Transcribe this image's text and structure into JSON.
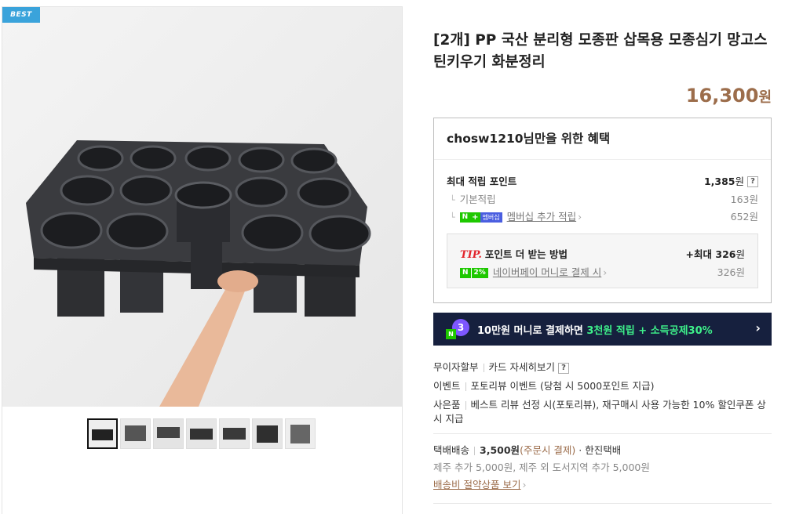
{
  "gallery": {
    "badge": "BEST",
    "thumbnail_count": 7
  },
  "product": {
    "title": "[2개] PP 국산 분리형 모종판 삽목용 모종심기 망고스틴키우기 화분정리",
    "price": "16,300",
    "currency": "원"
  },
  "benefit": {
    "heading": "chosw1210님만을 위한 혜택",
    "max_points_label": "최대 적립 포인트",
    "max_points_value": "1,385",
    "won": "원",
    "help": "?",
    "basic_label": "기본적립",
    "basic_value": "163원",
    "n_mark": "N",
    "plus_mark": "+",
    "membership_chip": "멤버십",
    "membership_label": "멤버십 추가 적립",
    "membership_value": "652원",
    "chevron": "›",
    "tip": {
      "label": "TIP.",
      "text": "포인트 더 받는 방법",
      "max_prefix": "+최대",
      "max_value": "326",
      "pct_chip": "2%",
      "npay_label": "네이버페이 머니로 결제 시",
      "npay_value": "326원"
    }
  },
  "banner": {
    "icon_number": "3",
    "text_prefix": "10만원 머니로 결제하면 ",
    "text_highlight": "3천원 적립 + 소득공제30%",
    "arrow": "›"
  },
  "info": {
    "installment": "무이자할부",
    "card_detail": "카드 자세히보기",
    "event_label": "이벤트",
    "event_text": "포토리뷰 이벤트 (당첨 시 5000포인트 지급)",
    "gift_label": "사은품",
    "gift_text": "베스트 리뷰 선정 시(포토리뷰), 재구매시 사용 가능한 10% 할인쿠폰 상시 지급"
  },
  "shipping": {
    "label": "택배배송",
    "fee": "3,500원",
    "fee_note": "(주문시 결제)",
    "carrier": "· 한진택배",
    "extra": "제주 추가 5,000원, 제주 외 도서지역 추가 5,000원",
    "saving_link": "배송비 절약상품 보기"
  },
  "colors": {
    "accent_brown": "#9c6d4b",
    "naver_green": "#1ec800",
    "banner_bg": "#16203e",
    "badge_blue": "#3aa3db"
  }
}
